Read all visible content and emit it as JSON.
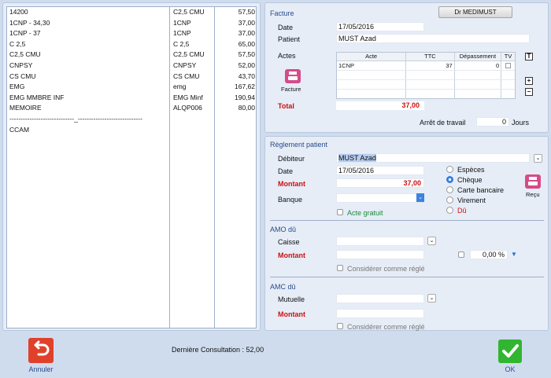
{
  "left_list": {
    "col1": [
      "14200",
      "1CNP - 34,30",
      "1CNP - 37",
      "C 2,5",
      "C2,5 CMU",
      "CNPSY",
      "CS CMU",
      "EMG",
      "EMG MMBRE INF",
      "MEMOIRE",
      "-----------------------------_-----------------------------",
      "CCAM"
    ],
    "col2": [
      "C2,5 CMU",
      "1CNP",
      "1CNP",
      "C 2,5",
      "C2,5 CMU",
      "CNPSY",
      "CS CMU",
      "emg",
      "EMG Minf",
      "ALQP006"
    ],
    "col3": [
      "57,50",
      "37,00",
      "37,00",
      "65,00",
      "57,50",
      "52,00",
      "43,70",
      "167,62",
      "190,94",
      "80,00"
    ]
  },
  "facture": {
    "title": "Facture",
    "doctor_button": "Dr MEDIMUST",
    "date_label": "Date",
    "date_value": "17/05/2016",
    "patient_label": "Patient",
    "patient_value": "MUST Azad",
    "actes_label": "Actes",
    "print_label": "Facture",
    "table_headers": [
      "Acte",
      "TTC",
      "Dépassement",
      "TV"
    ],
    "table_rows": [
      [
        "1CNP",
        "37",
        "0",
        ""
      ]
    ],
    "t_button": "T",
    "plus_button": "+",
    "minus_button": "−",
    "total_label": "Total",
    "total_value": "37,00",
    "arret_label": "Arrêt de travail",
    "arret_value": "0",
    "jours_label": "Jours"
  },
  "reglement": {
    "title": "Règlement patient",
    "debiteur_label": "Débiteur",
    "debiteur_value": "MUST Azad",
    "date_label": "Date",
    "date_value": "17/05/2016",
    "montant_label": "Montant",
    "montant_value": "37,00",
    "banque_label": "Banque",
    "acte_gratuit_label": "Acte gratuit",
    "recu_label": "Reçu",
    "payment_methods": [
      "Espèces",
      "Chèque",
      "Carte bancaire",
      "Virement",
      "Dû"
    ],
    "selected_method": "Chèque"
  },
  "amo": {
    "title": "AMO dû",
    "caisse_label": "Caisse",
    "montant_label": "Montant",
    "percent_value": "0,00 %",
    "considerer_label": "Considérer comme réglé"
  },
  "amc": {
    "title": "AMC dû",
    "mutuelle_label": "Mutuelle",
    "montant_label": "Montant",
    "considerer_label": "Considérer comme réglé"
  },
  "footer": {
    "derniere_consultation": "Dernière Consultation : 52,00",
    "annuler_label": "Annuler",
    "ok_label": "OK"
  },
  "colors": {
    "red_label": "#cc1111",
    "section_title": "#2a4a8a",
    "undo": "#e0412b",
    "ok": "#32b531",
    "print": "#d54b8a"
  }
}
